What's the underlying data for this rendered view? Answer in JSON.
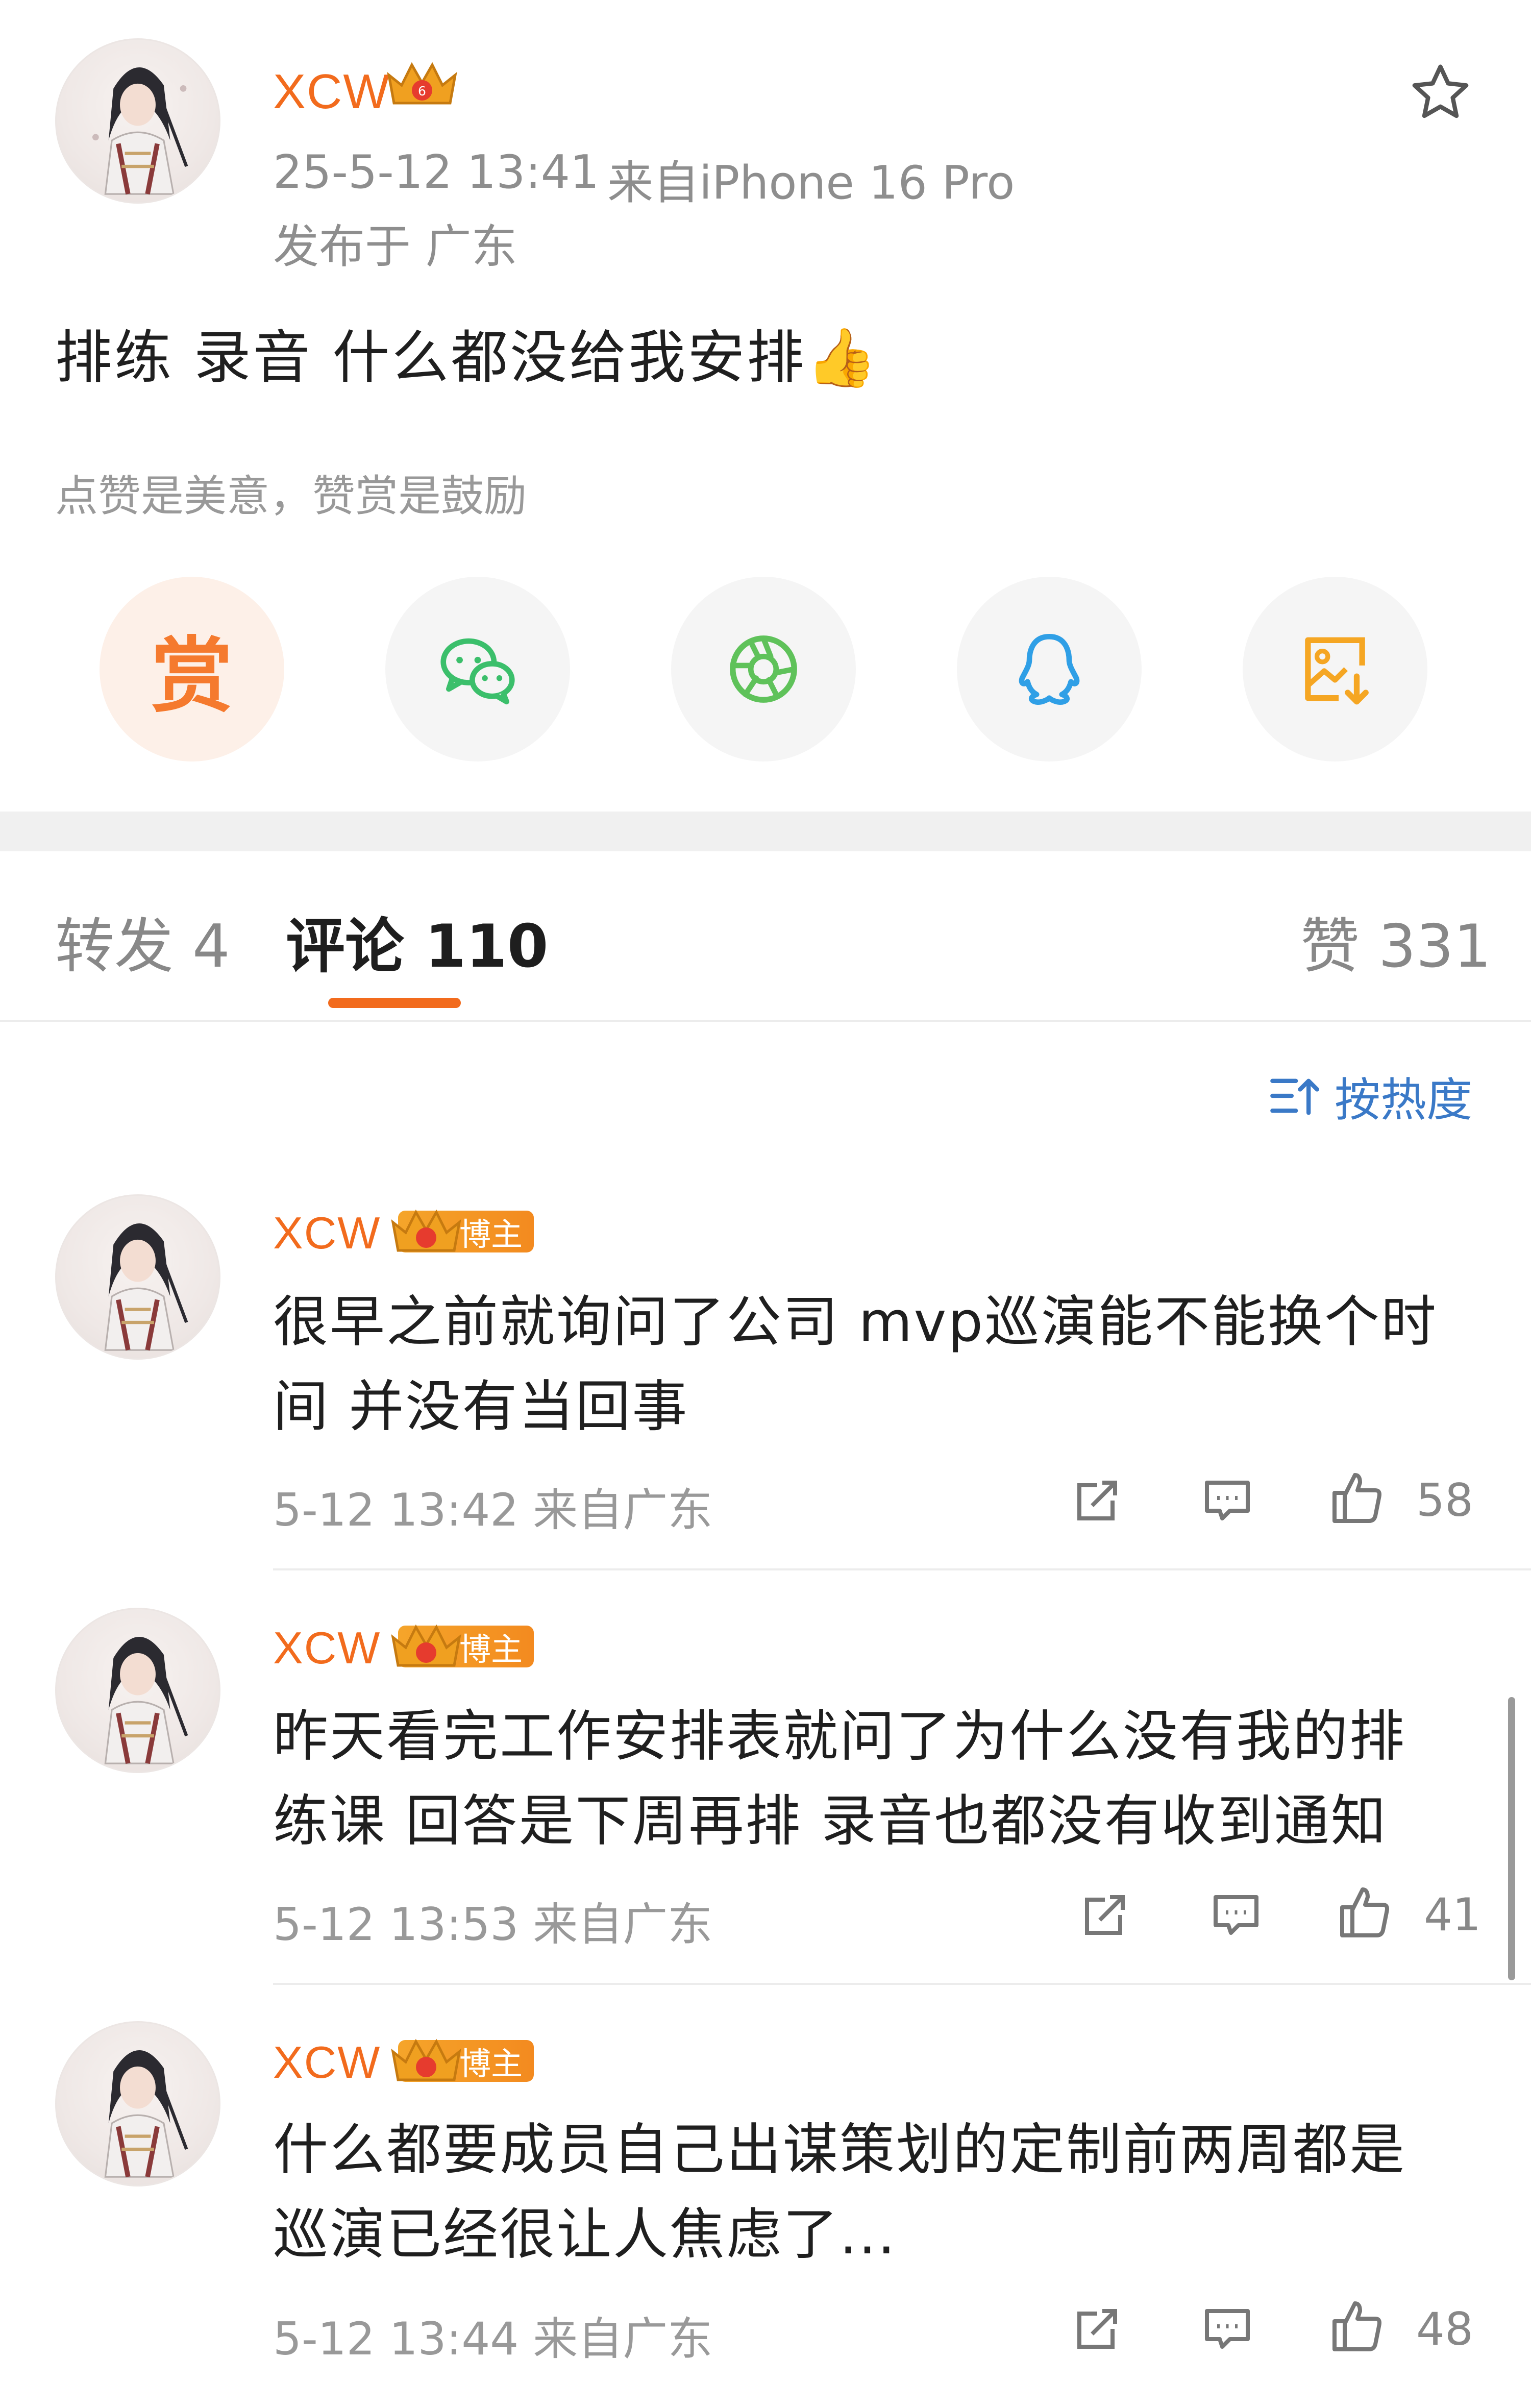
{
  "post": {
    "username": "XCW",
    "timestamp": "25-5-12 13:41",
    "source": "来自iPhone 16 Pro",
    "location": "发布于 广东",
    "text": "排练 录音 什么都没给我安排👍",
    "reward_hint": "点赞是美意，赞赏是鼓励",
    "reward_label": "赏",
    "share_targets": [
      "reward",
      "wechat",
      "moments",
      "qq",
      "save-image"
    ]
  },
  "tabs": {
    "repost": "转发 4",
    "comments": "评论 110",
    "likes": "赞 331"
  },
  "sort": {
    "label": "按热度"
  },
  "comments": [
    {
      "username": "XCW",
      "badge": "博主",
      "text": "很早之前就询问了公司 mvp巡演能不能换个时间 并没有当回事",
      "meta": "5-12 13:42  来自广东",
      "likes": "58"
    },
    {
      "username": "XCW",
      "badge": "博主",
      "text": "昨天看完工作安排表就问了为什么没有我的排练课  回答是下周再排 录音也都没有收到通知",
      "meta": "5-12 13:53  来自广东",
      "likes": "41"
    },
    {
      "username": "XCW",
      "badge": "博主",
      "text": "什么都要成员自己出谋策划的定制前两周都是巡演已经很让人焦虑了...",
      "meta": "5-12 13:44  来自广东",
      "likes": "48"
    }
  ],
  "colors": {
    "accent": "#f26b1d",
    "link": "#3a79c7",
    "wechat": "#3bbf6b",
    "moments": "#5fc25a",
    "qq": "#2f9fe6",
    "save": "#f5a623"
  }
}
